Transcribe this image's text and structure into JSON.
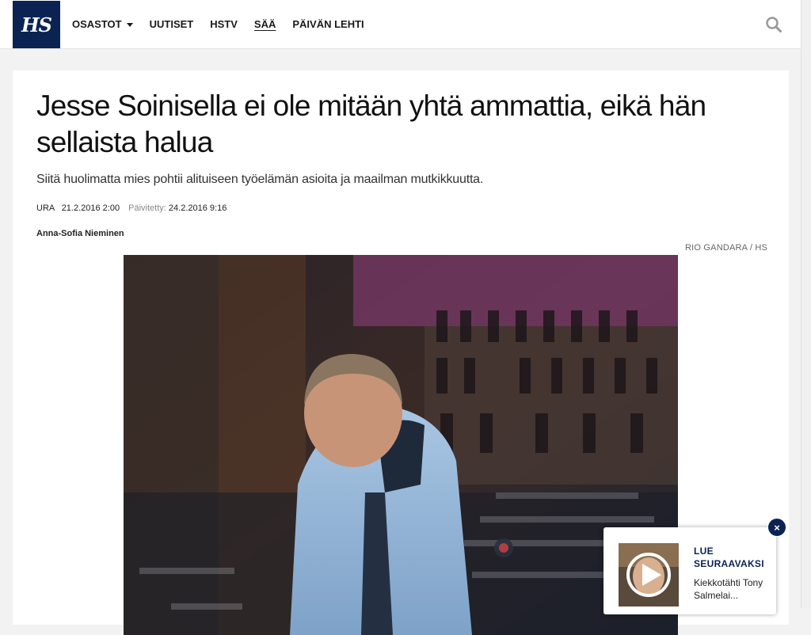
{
  "header": {
    "logo_text": "HS",
    "nav": [
      {
        "label": "OSASTOT",
        "dropdown": true,
        "active": false
      },
      {
        "label": "UUTISET",
        "active": false
      },
      {
        "label": "HSTV",
        "active": false
      },
      {
        "label": "SÄÄ",
        "active": true
      },
      {
        "label": "PÄIVÄN LEHTI",
        "active": false
      }
    ],
    "search_icon": "search-icon"
  },
  "article": {
    "headline": "Jesse Soinisella ei ole mitään yhtä ammattia, eikä hän sellaista halua",
    "lead": "Siitä huolimatta mies pohtii alituiseen työelämän asioita ja maailman mutkikkuutta.",
    "section": "URA",
    "published": "21.2.2016 2:00",
    "updated_label": "Päivitetty:",
    "updated": "24.2.2016 9:16",
    "author": "Anna-Sofia Nieminen",
    "photo_credit": "RIO GANDARA / HS"
  },
  "recommendation": {
    "title": "LUE SEURAAVAKSI",
    "text": "Kiekkotähti Tony Salmelai...",
    "close_label": "×",
    "play_icon": "play-icon"
  },
  "colors": {
    "brand": "#0a2352",
    "text": "#111111",
    "background": "#f2f2f2"
  }
}
